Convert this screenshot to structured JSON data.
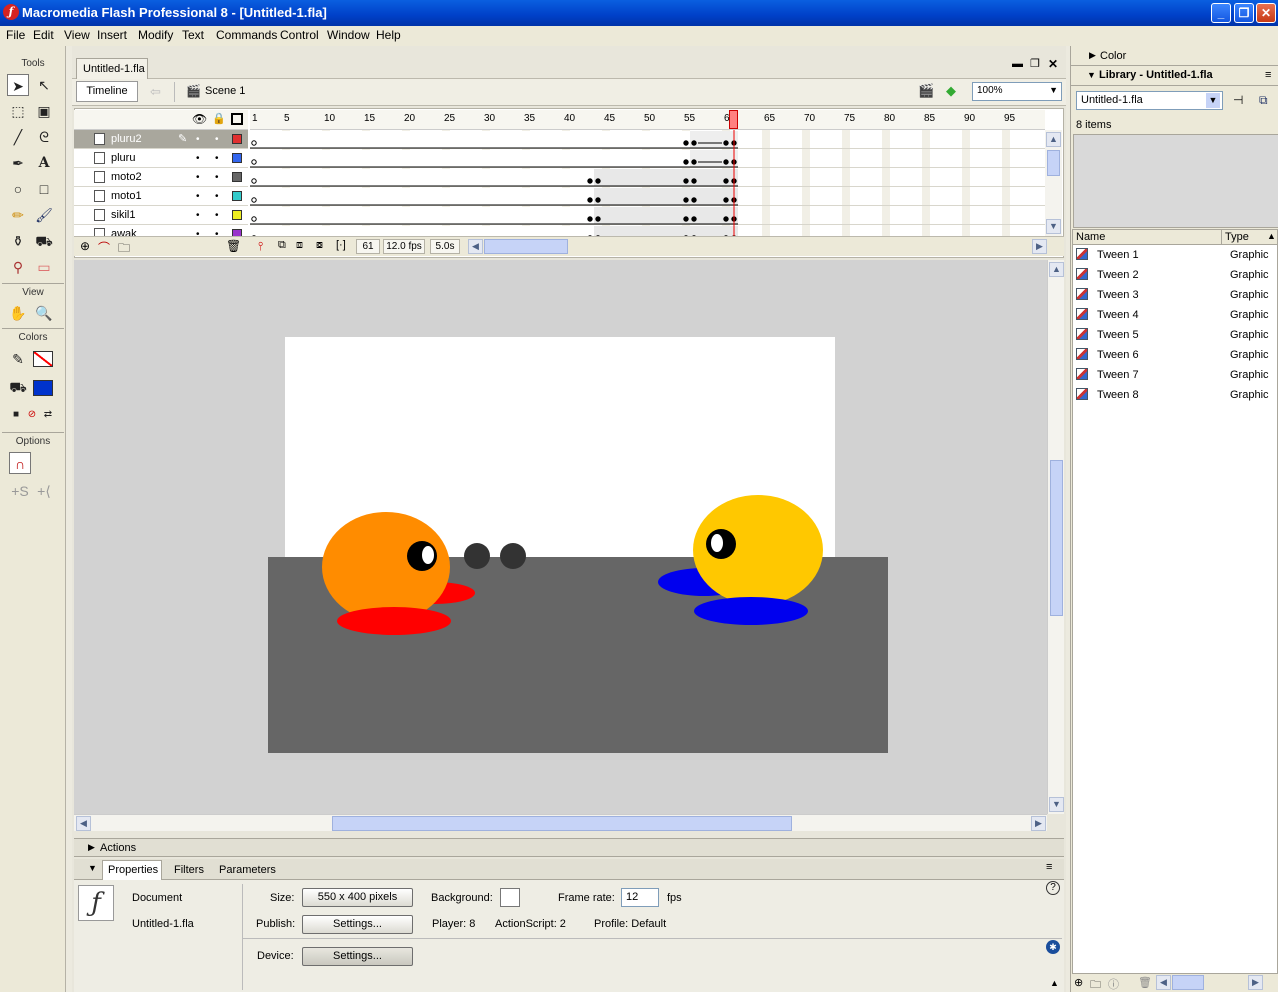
{
  "window": {
    "title": "Macromedia Flash Professional 8 - [Untitled-1.fla]"
  },
  "menu": [
    "File",
    "Edit",
    "View",
    "Insert",
    "Modify",
    "Text",
    "Commands",
    "Control",
    "Window",
    "Help"
  ],
  "tools": {
    "section_tools": "Tools",
    "section_view": "View",
    "section_colors": "Colors",
    "section_options": "Options",
    "stroke_color": "#ff0000",
    "fill_color": "#0033cc"
  },
  "document": {
    "tab": "Untitled-1.fla",
    "timeline_button": "Timeline",
    "scene": "Scene 1",
    "zoom": "100%"
  },
  "timeline": {
    "ruler": [
      "1",
      "5",
      "10",
      "15",
      "20",
      "25",
      "30",
      "35",
      "40",
      "45",
      "50",
      "55",
      "60",
      "65",
      "70",
      "75",
      "80",
      "85",
      "90",
      "95"
    ],
    "playhead_frame": 61,
    "layers": [
      {
        "name": "pluru2",
        "color": "#e03030",
        "active": true
      },
      {
        "name": "pluru",
        "color": "#3366ee",
        "active": false
      },
      {
        "name": "moto2",
        "color": "#666666",
        "active": false
      },
      {
        "name": "moto1",
        "color": "#33cccc",
        "active": false
      },
      {
        "name": "sikil1",
        "color": "#eeee22",
        "active": false
      },
      {
        "name": "awak",
        "color": "#9933cc",
        "active": false
      }
    ],
    "current_frame": "61",
    "fps": "12.0 fps",
    "elapsed": "5.0s"
  },
  "stage": {
    "width": 550,
    "height": 400,
    "background": "#ffffff",
    "ground_color": "#666666"
  },
  "panels": {
    "actions_title": "Actions",
    "tabs": [
      "Properties",
      "Filters",
      "Parameters"
    ]
  },
  "properties": {
    "type_label": "Document",
    "file_name": "Untitled-1.fla",
    "size_label": "Size:",
    "size_value": "550 x 400 pixels",
    "background_label": "Background:",
    "frame_rate_label": "Frame rate:",
    "frame_rate_value": "12",
    "fps_unit": "fps",
    "publish_label": "Publish:",
    "publish_settings": "Settings...",
    "player": "Player: 8",
    "actionscript": "ActionScript: 2",
    "profile": "Profile: Default",
    "device_label": "Device:",
    "device_settings": "Settings..."
  },
  "right_panel": {
    "color_title": "Color",
    "library_title": "Library - Untitled-1.fla",
    "library_select": "Untitled-1.fla",
    "item_count": "8 items",
    "col_name": "Name",
    "col_type": "Type",
    "items": [
      {
        "name": "Tween 1",
        "type": "Graphic"
      },
      {
        "name": "Tween 2",
        "type": "Graphic"
      },
      {
        "name": "Tween 3",
        "type": "Graphic"
      },
      {
        "name": "Tween 4",
        "type": "Graphic"
      },
      {
        "name": "Tween 5",
        "type": "Graphic"
      },
      {
        "name": "Tween 6",
        "type": "Graphic"
      },
      {
        "name": "Tween 7",
        "type": "Graphic"
      },
      {
        "name": "Tween 8",
        "type": "Graphic"
      }
    ]
  }
}
